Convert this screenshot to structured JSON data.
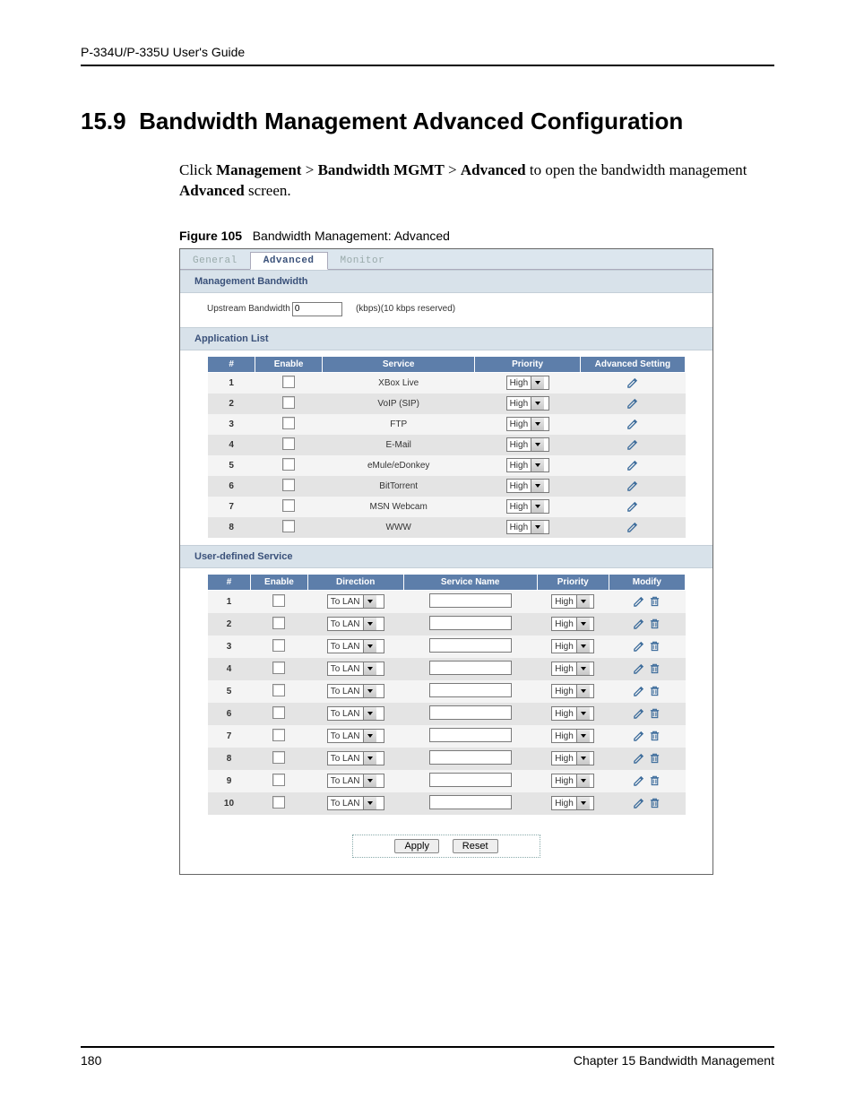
{
  "page": {
    "guide_title": "P-334U/P-335U User's Guide",
    "page_number": "180",
    "chapter_footer": "Chapter 15 Bandwidth Management"
  },
  "section": {
    "number": "15.9",
    "title": "Bandwidth Management Advanced Configuration",
    "intro_prefix": "Click ",
    "bc1": "Management",
    "sep": " > ",
    "bc2": "Bandwidth MGMT",
    "bc3": "Advanced",
    "intro_mid": " to open the bandwidth management ",
    "intro_bold_end": "Advanced",
    "intro_suffix": " screen."
  },
  "figure": {
    "label": "Figure 105",
    "caption": "Bandwidth Management: Advanced"
  },
  "tabs": {
    "general": "General",
    "advanced": "Advanced",
    "monitor": "Monitor"
  },
  "bands": {
    "mgmt_bw": "Management Bandwidth",
    "app_list": "Application List",
    "uds": "User-defined Service"
  },
  "mgmt": {
    "label": "Upstream Bandwidth",
    "value": "0",
    "suffix": "(kbps)(10 kbps reserved)"
  },
  "app_headers": {
    "num": "#",
    "enable": "Enable",
    "service": "Service",
    "priority": "Priority",
    "adv": "Advanced Setting"
  },
  "app_rows": [
    {
      "n": "1",
      "service": "XBox Live",
      "priority": "High"
    },
    {
      "n": "2",
      "service": "VoIP (SIP)",
      "priority": "High"
    },
    {
      "n": "3",
      "service": "FTP",
      "priority": "High"
    },
    {
      "n": "4",
      "service": "E-Mail",
      "priority": "High"
    },
    {
      "n": "5",
      "service": "eMule/eDonkey",
      "priority": "High"
    },
    {
      "n": "6",
      "service": "BitTorrent",
      "priority": "High"
    },
    {
      "n": "7",
      "service": "MSN Webcam",
      "priority": "High"
    },
    {
      "n": "8",
      "service": "WWW",
      "priority": "High"
    }
  ],
  "uds_headers": {
    "num": "#",
    "enable": "Enable",
    "direction": "Direction",
    "svcname": "Service Name",
    "priority": "Priority",
    "modify": "Modify"
  },
  "uds_rows": [
    {
      "n": "1",
      "direction": "To LAN",
      "priority": "High"
    },
    {
      "n": "2",
      "direction": "To LAN",
      "priority": "High"
    },
    {
      "n": "3",
      "direction": "To LAN",
      "priority": "High"
    },
    {
      "n": "4",
      "direction": "To LAN",
      "priority": "High"
    },
    {
      "n": "5",
      "direction": "To LAN",
      "priority": "High"
    },
    {
      "n": "6",
      "direction": "To LAN",
      "priority": "High"
    },
    {
      "n": "7",
      "direction": "To LAN",
      "priority": "High"
    },
    {
      "n": "8",
      "direction": "To LAN",
      "priority": "High"
    },
    {
      "n": "9",
      "direction": "To LAN",
      "priority": "High"
    },
    {
      "n": "10",
      "direction": "To LAN",
      "priority": "High"
    }
  ],
  "buttons": {
    "apply": "Apply",
    "reset": "Reset"
  }
}
